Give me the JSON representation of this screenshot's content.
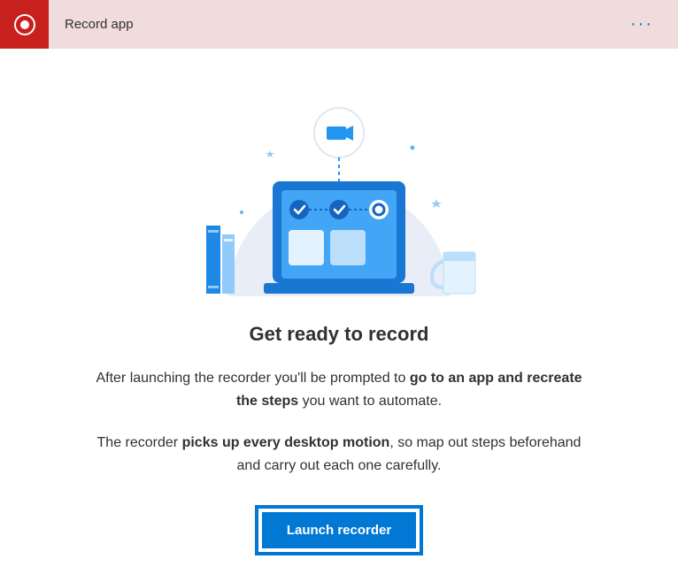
{
  "header": {
    "title": "Record app"
  },
  "content": {
    "heading": "Get ready to record",
    "p1_prefix": "After launching the recorder you'll be prompted to ",
    "p1_bold": "go to an app and recreate the steps",
    "p1_suffix": " you want to automate.",
    "p2_prefix": "The recorder ",
    "p2_bold": "picks up every desktop motion",
    "p2_suffix": ", so map out steps beforehand and carry out each one carefully."
  },
  "button": {
    "launch_label": "Launch recorder"
  }
}
